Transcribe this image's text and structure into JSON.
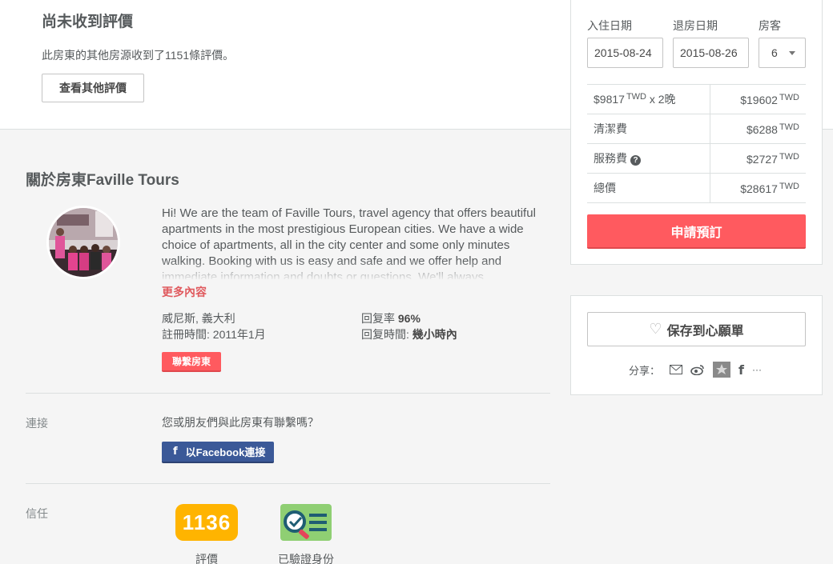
{
  "reviews": {
    "title": "尚未收到評價",
    "subtitle": "此房東的其他房源收到了1151條評價。",
    "button": "查看其他評價"
  },
  "host": {
    "title": "關於房東Faville Tours",
    "about": "Hi! We are the team of Faville Tours, travel agency that offers beautiful apartments in the most prestigious European cities. We have a wide choice of apartments, all in the city center and some only minutes walking. Booking with us is easy and safe and we offer help and immediate information and doubts or questions. We'll always",
    "more": "更多內容",
    "location": "威尼斯, 義大利",
    "member_since": "註冊時間: 2011年1月",
    "response_rate_label": "回复率",
    "response_rate": "96%",
    "response_time_label": "回复時間:",
    "response_time": "幾小時內",
    "contact_button": "聯繫房東"
  },
  "connect": {
    "label": "連接",
    "question": "您或朋友們與此房東有聯繫嗎？",
    "fb_icon": "f",
    "fb_button": "以Facebook連接"
  },
  "trust": {
    "label": "信任",
    "review_count": "1136",
    "review_label": "評價",
    "verified_label": "已驗證身份"
  },
  "booking": {
    "checkin_label": "入住日期",
    "checkout_label": "退房日期",
    "guests_label": "房客",
    "checkin": "2015-08-24",
    "checkout": "2015-08-26",
    "guests": "6",
    "currency": "TWD",
    "rows": [
      {
        "label": "$9817",
        "label_suffix": "x 2晚",
        "value": "$19602"
      },
      {
        "label": "清潔費",
        "value": "$6288"
      },
      {
        "label": "服務費",
        "value": "$2727"
      },
      {
        "label": "總價",
        "value": "$28617"
      }
    ],
    "book_button": "申請預訂"
  },
  "wishlist": {
    "button": "保存到心願單",
    "share_label": "分享：",
    "share_icons": [
      "mail-icon",
      "weibo-icon",
      "qzone-icon",
      "facebook-icon",
      "more-icon"
    ],
    "more": "···"
  },
  "colors": {
    "brand": "#ff5a5f",
    "facebook": "#3b5998",
    "badge": "#ffb400"
  }
}
